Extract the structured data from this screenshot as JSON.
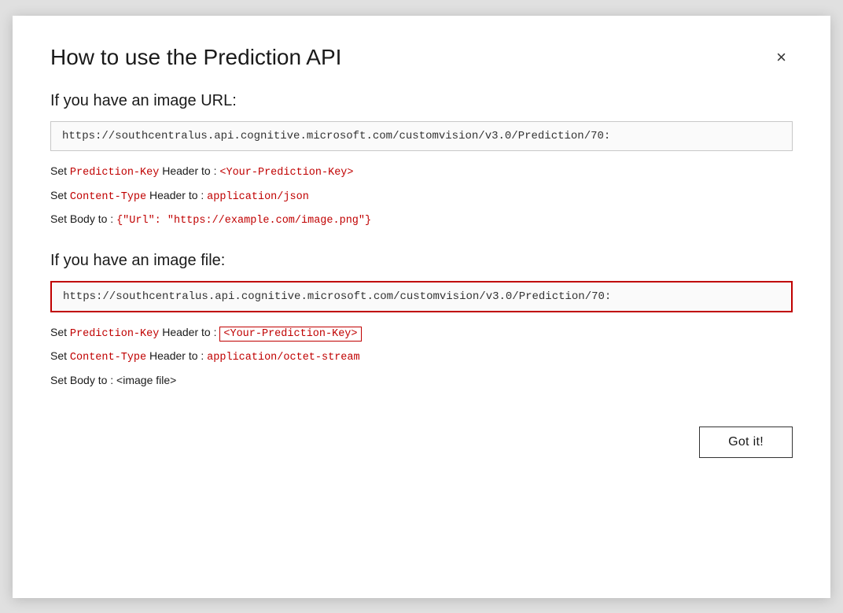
{
  "dialog": {
    "title": "How to use the Prediction API",
    "close_label": "×",
    "section_url": {
      "title": "If you have an image URL:",
      "url": "https://southcentralus.api.cognitive.microsoft.com/customvision/v3.0/Prediction/70:",
      "instructions": [
        {
          "id": "line1",
          "prefix": "Set ",
          "keyword": "Prediction-Key",
          "middle": " Header to : ",
          "value": "<Your-Prediction-Key>",
          "value_boxed": false
        },
        {
          "id": "line2",
          "prefix": "Set ",
          "keyword": "Content-Type",
          "middle": " Header to : ",
          "value": "application/json",
          "value_boxed": false
        },
        {
          "id": "line3",
          "prefix": "Set Body to : ",
          "keyword": "",
          "middle": "",
          "value": "{\"Url\": \"https://example.com/image.png\"}",
          "value_boxed": false
        }
      ]
    },
    "section_file": {
      "title": "If you have an image file:",
      "url": "https://southcentralus.api.cognitive.microsoft.com/customvision/v3.0/Prediction/70:",
      "instructions": [
        {
          "id": "file_line1",
          "prefix": "Set ",
          "keyword": "Prediction-Key",
          "middle": " Header to : ",
          "value": "<Your-Prediction-Key>",
          "value_boxed": true
        },
        {
          "id": "file_line2",
          "prefix": "Set ",
          "keyword": "Content-Type",
          "middle": " Header to : ",
          "value": "application/octet-stream",
          "value_boxed": false
        },
        {
          "id": "file_line3",
          "prefix": "Set Body to : <image file>",
          "keyword": "",
          "middle": "",
          "value": "",
          "value_boxed": false
        }
      ]
    },
    "footer": {
      "got_it_label": "Got it!"
    }
  }
}
